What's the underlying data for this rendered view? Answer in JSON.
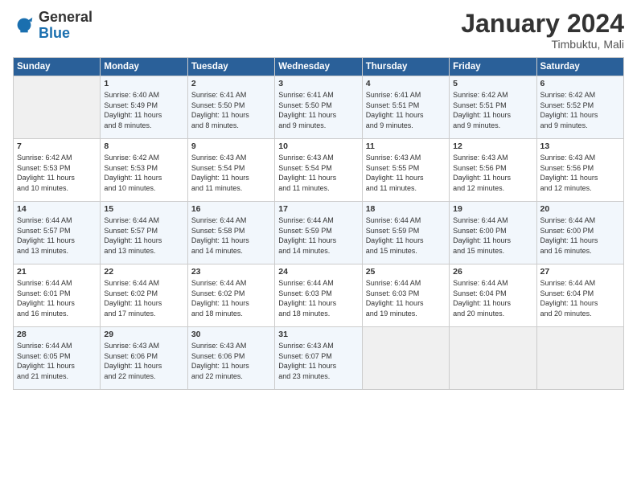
{
  "logo": {
    "general": "General",
    "blue": "Blue"
  },
  "title": "January 2024",
  "subtitle": "Timbuktu, Mali",
  "headers": [
    "Sunday",
    "Monday",
    "Tuesday",
    "Wednesday",
    "Thursday",
    "Friday",
    "Saturday"
  ],
  "weeks": [
    [
      {
        "day": "",
        "empty": true
      },
      {
        "day": "1",
        "sunrise": "6:40 AM",
        "sunset": "5:49 PM",
        "daylight": "11 hours and 8 minutes."
      },
      {
        "day": "2",
        "sunrise": "6:41 AM",
        "sunset": "5:50 PM",
        "daylight": "11 hours and 8 minutes."
      },
      {
        "day": "3",
        "sunrise": "6:41 AM",
        "sunset": "5:50 PM",
        "daylight": "11 hours and 9 minutes."
      },
      {
        "day": "4",
        "sunrise": "6:41 AM",
        "sunset": "5:51 PM",
        "daylight": "11 hours and 9 minutes."
      },
      {
        "day": "5",
        "sunrise": "6:42 AM",
        "sunset": "5:51 PM",
        "daylight": "11 hours and 9 minutes."
      },
      {
        "day": "6",
        "sunrise": "6:42 AM",
        "sunset": "5:52 PM",
        "daylight": "11 hours and 9 minutes."
      }
    ],
    [
      {
        "day": "7",
        "sunrise": "6:42 AM",
        "sunset": "5:53 PM",
        "daylight": "11 hours and 10 minutes."
      },
      {
        "day": "8",
        "sunrise": "6:42 AM",
        "sunset": "5:53 PM",
        "daylight": "11 hours and 10 minutes."
      },
      {
        "day": "9",
        "sunrise": "6:43 AM",
        "sunset": "5:54 PM",
        "daylight": "11 hours and 11 minutes."
      },
      {
        "day": "10",
        "sunrise": "6:43 AM",
        "sunset": "5:54 PM",
        "daylight": "11 hours and 11 minutes."
      },
      {
        "day": "11",
        "sunrise": "6:43 AM",
        "sunset": "5:55 PM",
        "daylight": "11 hours and 11 minutes."
      },
      {
        "day": "12",
        "sunrise": "6:43 AM",
        "sunset": "5:56 PM",
        "daylight": "11 hours and 12 minutes."
      },
      {
        "day": "13",
        "sunrise": "6:43 AM",
        "sunset": "5:56 PM",
        "daylight": "11 hours and 12 minutes."
      }
    ],
    [
      {
        "day": "14",
        "sunrise": "6:44 AM",
        "sunset": "5:57 PM",
        "daylight": "11 hours and 13 minutes."
      },
      {
        "day": "15",
        "sunrise": "6:44 AM",
        "sunset": "5:57 PM",
        "daylight": "11 hours and 13 minutes."
      },
      {
        "day": "16",
        "sunrise": "6:44 AM",
        "sunset": "5:58 PM",
        "daylight": "11 hours and 14 minutes."
      },
      {
        "day": "17",
        "sunrise": "6:44 AM",
        "sunset": "5:59 PM",
        "daylight": "11 hours and 14 minutes."
      },
      {
        "day": "18",
        "sunrise": "6:44 AM",
        "sunset": "5:59 PM",
        "daylight": "11 hours and 15 minutes."
      },
      {
        "day": "19",
        "sunrise": "6:44 AM",
        "sunset": "6:00 PM",
        "daylight": "11 hours and 15 minutes."
      },
      {
        "day": "20",
        "sunrise": "6:44 AM",
        "sunset": "6:00 PM",
        "daylight": "11 hours and 16 minutes."
      }
    ],
    [
      {
        "day": "21",
        "sunrise": "6:44 AM",
        "sunset": "6:01 PM",
        "daylight": "11 hours and 16 minutes."
      },
      {
        "day": "22",
        "sunrise": "6:44 AM",
        "sunset": "6:02 PM",
        "daylight": "11 hours and 17 minutes."
      },
      {
        "day": "23",
        "sunrise": "6:44 AM",
        "sunset": "6:02 PM",
        "daylight": "11 hours and 18 minutes."
      },
      {
        "day": "24",
        "sunrise": "6:44 AM",
        "sunset": "6:03 PM",
        "daylight": "11 hours and 18 minutes."
      },
      {
        "day": "25",
        "sunrise": "6:44 AM",
        "sunset": "6:03 PM",
        "daylight": "11 hours and 19 minutes."
      },
      {
        "day": "26",
        "sunrise": "6:44 AM",
        "sunset": "6:04 PM",
        "daylight": "11 hours and 20 minutes."
      },
      {
        "day": "27",
        "sunrise": "6:44 AM",
        "sunset": "6:04 PM",
        "daylight": "11 hours and 20 minutes."
      }
    ],
    [
      {
        "day": "28",
        "sunrise": "6:44 AM",
        "sunset": "6:05 PM",
        "daylight": "11 hours and 21 minutes."
      },
      {
        "day": "29",
        "sunrise": "6:43 AM",
        "sunset": "6:06 PM",
        "daylight": "11 hours and 22 minutes."
      },
      {
        "day": "30",
        "sunrise": "6:43 AM",
        "sunset": "6:06 PM",
        "daylight": "11 hours and 22 minutes."
      },
      {
        "day": "31",
        "sunrise": "6:43 AM",
        "sunset": "6:07 PM",
        "daylight": "11 hours and 23 minutes."
      },
      {
        "day": "",
        "empty": true
      },
      {
        "day": "",
        "empty": true
      },
      {
        "day": "",
        "empty": true
      }
    ]
  ],
  "labels": {
    "sunrise": "Sunrise:",
    "sunset": "Sunset:",
    "daylight": "Daylight:"
  }
}
